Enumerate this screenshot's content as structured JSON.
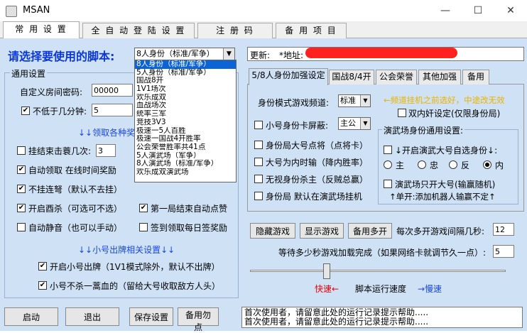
{
  "window": {
    "title": "MSAN",
    "minimize": "—",
    "maximize": "☐",
    "close": "✕"
  },
  "top_tabs": [
    "常 用 设 置",
    "全 自 动 登 陆 设 置",
    "注  册  码",
    "备 用 项 目"
  ],
  "script_prompt": "请选择要使用的脚本:",
  "script_select": {
    "value": "8人身份（标准/军争）",
    "arrow": "▼"
  },
  "script_options": [
    "8人身份（标准/军争）",
    "5人身份（标准/军争）",
    "国战8开",
    "1V1场次",
    "欢乐成双",
    "血战场次",
    "统率三军",
    "竞技3V3",
    "极速一5人百胜",
    "极速一国战4开胜率",
    "公会荣誉胜率共41点",
    "5人演武场（军争）",
    "8人演武场（标准/军争）",
    "欢乐成双演武场"
  ],
  "general": {
    "title": "通用设置",
    "room_pwd_label": "自定义房间密码:",
    "room_pwd_value": "00000",
    "min_score_label": "不低于几分钟:",
    "min_score_value": "5",
    "reward_hint": "↓↓领取各种奖",
    "hangup_label": "挂结束击蓑几次:",
    "hangup_value": "3",
    "options_left": [
      "自动领取  在线时间奖励",
      "不挂连弩（默认不去挂）",
      "开启酉杀（可选可不选）",
      "自动静音（也可以手动）"
    ],
    "options_right": [
      "第一局结束自动点赞",
      "签到领取每日签奖励"
    ],
    "option_states_left": [
      true,
      true,
      true,
      false
    ],
    "option_states_right": [
      true,
      false
    ],
    "small_section": "↓↓小号出牌相关设置↓↓",
    "small_opts": [
      "开启小号出牌（1V1模式除外，默认不出牌）",
      "小号不杀一蒿血的（留给大号收取敌方人头）"
    ],
    "small_states": [
      true,
      true
    ]
  },
  "right": {
    "update_label": "更新:",
    "addr_label": "*地址:",
    "tabs": [
      "5/8人身份加强设定",
      "国战8/4开",
      "公会荣誉",
      "其他加强",
      "备用"
    ],
    "mode_label": "身份模式游戏频道:",
    "mode_value": "标准",
    "mode_hint": "←频道挂机之前选好，中途改无效",
    "double_label": "双内奸设定(仅限身份局)",
    "mask_label": "小号身份卡屏蔽:",
    "mask_value": "主公",
    "lord_opts": [
      "身份局大号点将（点将卡）",
      "大号为内时输（降内胜率）",
      "无视身份杀主（反贼总赢）",
      "身份局  默认在演武场挂机"
    ],
    "arena_title": "演武场身份通用设置:",
    "arena_big": "↓开启演武大号自选身份↓:",
    "radio_opts": [
      "主",
      "忠",
      "反",
      "内"
    ],
    "radio_selected": 3,
    "arena_small": "演武场只开大号(输赢随机)",
    "arena_hint": "↑单开:添加机器人输赢不定↑"
  },
  "controls": {
    "hide": "隐藏游戏",
    "show": "显示游戏",
    "multi": "备用多开",
    "interval_label": "每次多开游戏间隔几秒:",
    "interval_value": "12",
    "wait_label": "等待多少秒游戏加载完成（如果网络卡就调节久一点）:",
    "wait_value": "5",
    "speed_fast": "快速←",
    "speed_label": "脚本运行速度",
    "speed_slow": "→慢速",
    "speed_level": 0.3
  },
  "bottom": {
    "start": "启动",
    "exit": "退出",
    "save": "保存设置",
    "backup": "备用勿点",
    "log_lines": [
      "首次使用者，请留意此处的运行记录提示帮助.....",
      "首次使用者，请留意此处的运行记录提示帮助....."
    ]
  }
}
